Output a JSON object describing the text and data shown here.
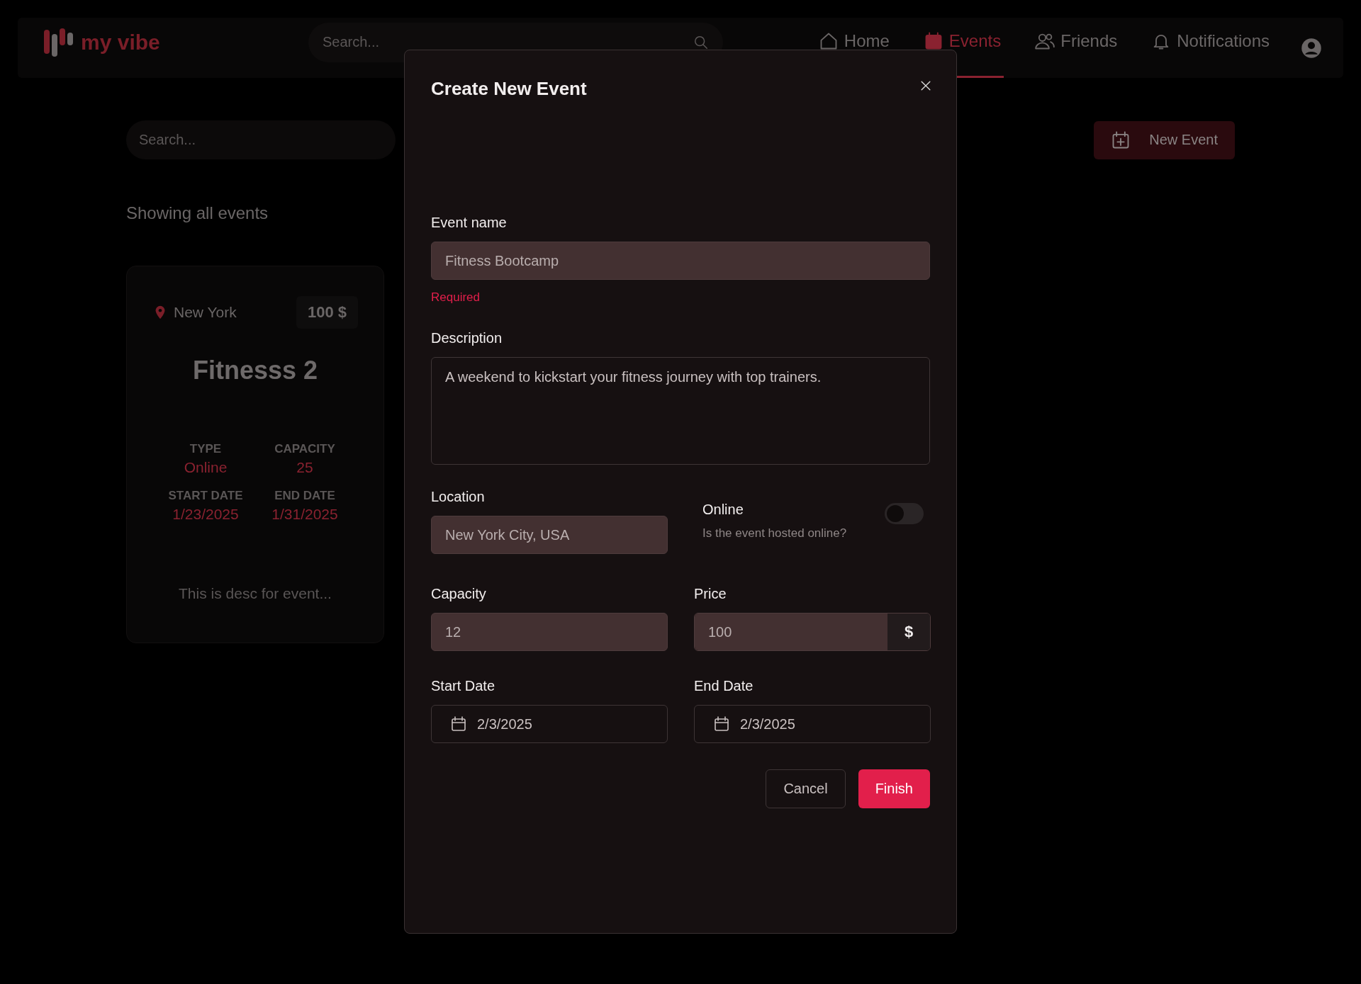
{
  "header": {
    "logo": "my vibe",
    "search": {
      "placeholder": "Search..."
    },
    "nav": [
      {
        "label": "Home",
        "selected": false
      },
      {
        "label": "Events",
        "selected": true
      },
      {
        "label": "Friends",
        "selected": false
      },
      {
        "label": "Notifications",
        "selected": false
      }
    ]
  },
  "toolbar": {
    "search": {
      "placeholder": "Search..."
    },
    "new_event_button": "New Event"
  },
  "results_label": "Showing all events",
  "events": [
    {
      "location": "New York",
      "price": "100 $",
      "title": "Fitnesss 2",
      "fields": [
        {
          "label": "TYPE",
          "value": "Online"
        },
        {
          "label": "CAPACITY",
          "value": "25"
        },
        {
          "label": "START DATE",
          "value": "1/23/2025"
        },
        {
          "label": "END DATE",
          "value": "1/31/2025"
        }
      ],
      "description": "This is desc for event..."
    }
  ],
  "modal": {
    "title": "Create New Event",
    "event_name": {
      "label": "Event name",
      "value": "Fitness Bootcamp",
      "error": "Required"
    },
    "description": {
      "label": "Description",
      "value": "A weekend to kickstart your fitness journey with top trainers."
    },
    "location": {
      "label": "Location",
      "value": "New York City, USA"
    },
    "online": {
      "label": "Online",
      "hint": "Is the event hosted online?",
      "on": false
    },
    "capacity": {
      "label": "Capacity",
      "value": "12"
    },
    "price": {
      "label": "Price",
      "value": "100",
      "unit": "$"
    },
    "start_date": {
      "label": "Start Date",
      "value": "2/3/2025"
    },
    "end_date": {
      "label": "End Date",
      "value": "2/3/2025"
    },
    "buttons": [
      {
        "label": "Cancel",
        "kind": "secondary"
      },
      {
        "label": "Finish",
        "kind": "primary"
      }
    ]
  }
}
